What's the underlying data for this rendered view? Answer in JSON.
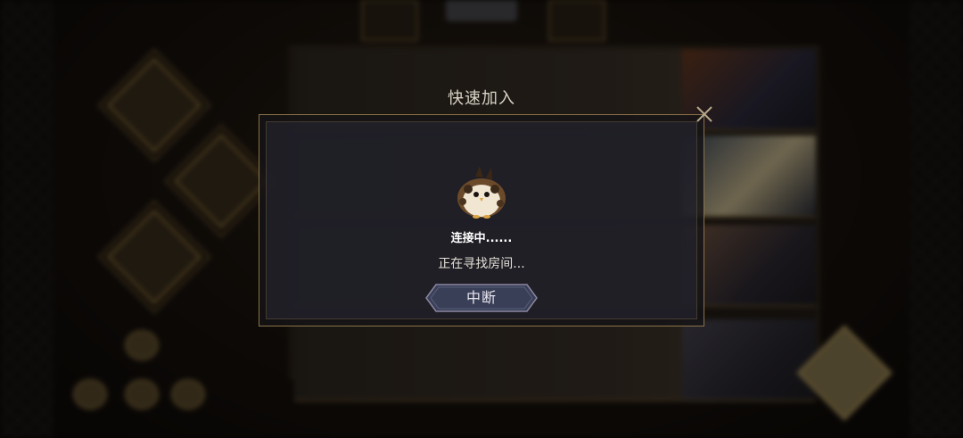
{
  "dialog": {
    "title": "快速加入",
    "status_main": "连接中......",
    "status_sub": "正在寻找房间...",
    "abort_label": "中断",
    "close_icon": "close-x-icon",
    "mascot_icon": "owl-mascot-icon"
  },
  "colors": {
    "frame_gold": "#8a7448",
    "button_fill": "#3a3f58",
    "text_light": "#e4e0d6"
  }
}
